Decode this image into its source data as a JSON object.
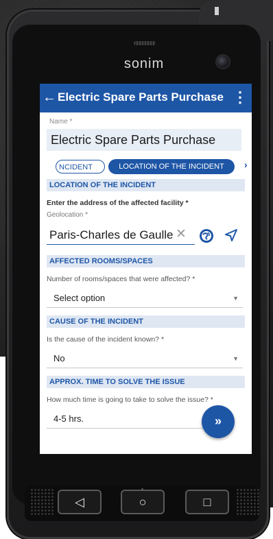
{
  "device": {
    "brand": "sonim"
  },
  "appbar": {
    "back_icon": "←",
    "title": "Electric Spare Parts Purchase",
    "menu_icon": "⋮"
  },
  "name_field": {
    "label": "Name *",
    "value": "Electric Spare Parts Purchase"
  },
  "tabs": {
    "items": [
      "NCIDENT",
      "LOCATION OF THE INCIDENT"
    ],
    "active": "LOCATION OF THE INCIDENT",
    "next_icon": "›"
  },
  "sections": {
    "location": {
      "header": "LOCATION OF THE INCIDENT",
      "question": "Enter the address of the affected facility *",
      "geo_label": "Geolocation *",
      "geo_value": "Paris-Charles de Gaulle",
      "clear_icon": "✕"
    },
    "rooms": {
      "header": "AFFECTED ROOMS/SPACES",
      "question": "Number of rooms/spaces that were affected? *",
      "select_value": "Select option"
    },
    "cause": {
      "header": "CAUSE OF THE INCIDENT",
      "question": "Is the cause of the incident known? *",
      "select_value": "No"
    },
    "time": {
      "header": "APPROX. TIME TO SOLVE THE ISSUE",
      "question": "How much time is going to take to solve the issue? *",
      "select_value": "4-5 hrs."
    }
  },
  "fab": {
    "icon": "»"
  },
  "hardware_buttons": {
    "back": "◁",
    "home": "○",
    "recent": "□"
  },
  "colors": {
    "primary": "#1e56a6",
    "section_bg": "#dfe7f3",
    "input_bg": "#e8eef6"
  }
}
